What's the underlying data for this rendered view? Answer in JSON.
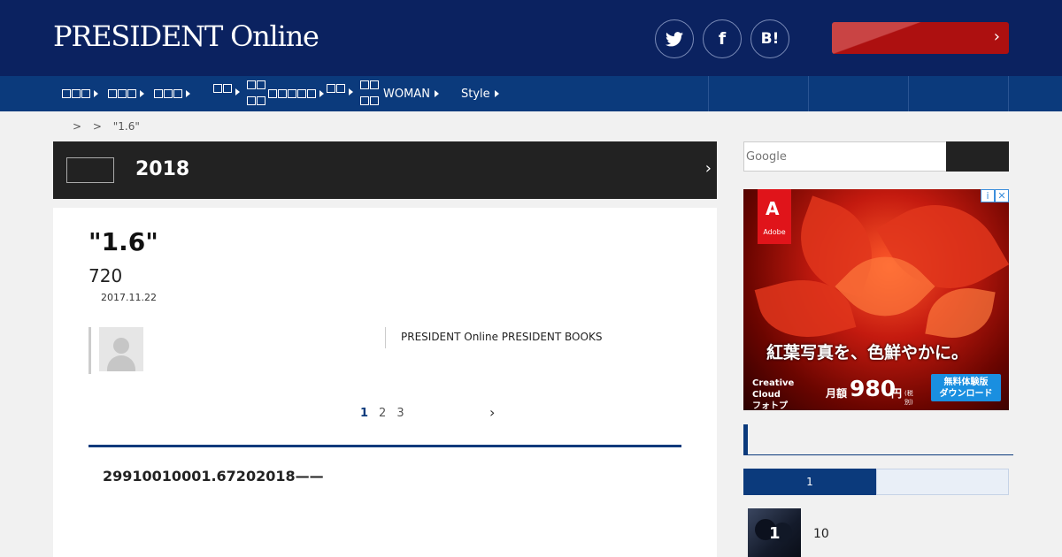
{
  "header": {
    "logo": "PRESIDENT Online",
    "social": {
      "twitter": "twitter-icon",
      "facebook": "f",
      "hatena": "B!"
    },
    "cta_chevron": "›"
  },
  "nav": {
    "items": [
      {
        "label": ""
      },
      {
        "label": ""
      },
      {
        "label": ""
      },
      {
        "label": ""
      },
      {
        "label": ""
      },
      {
        "label": ""
      },
      {
        "label": "WOMAN"
      },
      {
        "label": "Style"
      }
    ]
  },
  "breadcrumb": {
    "sep": ">",
    "current": "\"1.6\""
  },
  "category": {
    "year": "2018",
    "chevron": "›"
  },
  "article": {
    "title": "\"1.6\"",
    "subtitle": "720",
    "date": "2017.11.22",
    "source": "PRESIDENT Online PRESIDENT BOOKS",
    "pages": [
      "1",
      "2",
      "3"
    ],
    "next": "›",
    "summary": "29910010001.67202018——"
  },
  "sidebar": {
    "search": {
      "placeholder": "Google"
    },
    "ad": {
      "brand": "Adobe",
      "brand_mark": "A",
      "headline": "紅葉写真を、色鮮やかに。",
      "product_line1": "Creative Cloud",
      "product_line2": "フォトプラン",
      "price_label": "月額",
      "price": "980",
      "price_unit": "円",
      "tax_note": "(税別)",
      "cta_line1": "無料体験版",
      "cta_line2": "ダウンロード",
      "info": "i",
      "close": "✕"
    },
    "ranking": {
      "tab_active": "1",
      "item": {
        "rank": "1",
        "text": "10"
      }
    }
  },
  "colors": {
    "header_bg": "#0b2260",
    "nav_bg": "#0b3a7c",
    "accent_red": "#ad1010",
    "dark_band": "#222222"
  }
}
